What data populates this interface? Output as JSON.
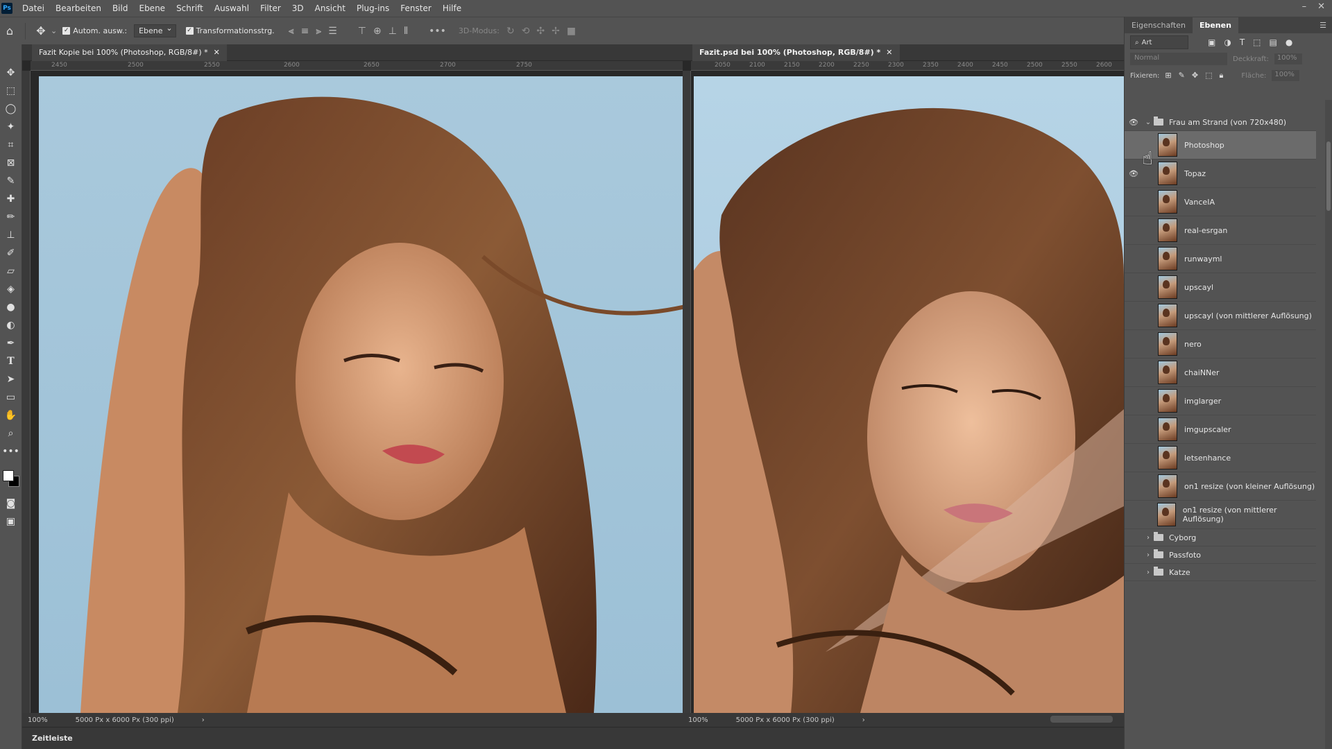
{
  "menubar": {
    "logo": "Ps",
    "items": [
      "Datei",
      "Bearbeiten",
      "Bild",
      "Ebene",
      "Schrift",
      "Auswahl",
      "Filter",
      "3D",
      "Ansicht",
      "Plug-ins",
      "Fenster",
      "Hilfe"
    ]
  },
  "options": {
    "auto_select_label": "Autom. ausw.:",
    "auto_select_target": "Ebene",
    "transform_label": "Transformationsstrg.",
    "mode_3d_label": "3D-Modus:"
  },
  "doc_left": {
    "tab_title": "Fazit Kopie bei 100% (Photoshop, RGB/8#) *",
    "ruler": [
      "2450",
      "2500",
      "2550",
      "2600",
      "2650",
      "2700",
      "2750"
    ],
    "zoom": "100%",
    "size": "5000 Px x 6000 Px (300 ppi)"
  },
  "doc_right": {
    "tab_title": "Fazit.psd bei 100% (Photoshop, RGB/8#) *",
    "ruler": [
      "2050",
      "2100",
      "2150",
      "2200",
      "2250",
      "2300",
      "2350",
      "2400",
      "2450",
      "2500",
      "2550",
      "2600"
    ],
    "zoom": "100%",
    "size": "5000 Px x 6000 Px (300 ppi)"
  },
  "timeline": {
    "label": "Zeitleiste"
  },
  "panels": {
    "tabs": [
      "Eigenschaften",
      "Ebenen"
    ],
    "filter_label": "Art",
    "blend_mode": "Normal",
    "opacity_label": "Deckkraft:",
    "opacity_value": "100%",
    "lock_label": "Fixieren:",
    "fill_label": "Fläche:",
    "fill_value": "100%"
  },
  "layers": {
    "group_open": "Frau am Strand (von 720x480)",
    "items": [
      "Photoshop",
      "Topaz",
      "VanceIA",
      "real-esrgan",
      "runwayml",
      "upscayl",
      "upscayl (von mittlerer Auflösung)",
      "nero",
      "chaiNNer",
      "imglarger",
      "imgupscaler",
      "letsenhance",
      "on1 resize (von kleiner Auflösung)",
      "on1 resize (von mittlerer Auflösung)"
    ],
    "groups_closed": [
      "Cyborg",
      "Passfoto",
      "Katze"
    ]
  },
  "colors": {
    "panel_bg": "#535353",
    "canvas_bg": "#282828",
    "selected_layer": "#6b6b6b"
  }
}
